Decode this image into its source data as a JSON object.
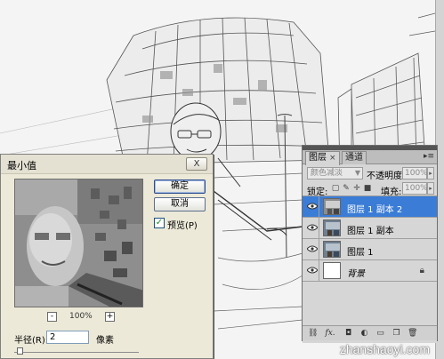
{
  "dialog": {
    "title": "最小值",
    "close_label": "X",
    "ok_label": "确定",
    "cancel_label": "取消",
    "preview_label": "预览(P)",
    "preview_checked": true,
    "zoom_minus": "-",
    "zoom_plus": "+",
    "zoom_value": "100%",
    "radius_label": "半径(R):",
    "radius_value": "2",
    "radius_unit": "像素"
  },
  "layers_panel": {
    "tab_layers": "图层",
    "tab_layers_close": "×",
    "tab_channels": "通道",
    "menu_glyph": "▸≡",
    "blend_mode": "颜色减淡",
    "opacity_label": "不透明度:",
    "opacity_value": "100%",
    "lock_label": "锁定:",
    "fill_label": "填充:",
    "fill_value": "100%",
    "layers": [
      {
        "name": "图层 1 副本 2",
        "selected": true,
        "thumb": "photo"
      },
      {
        "name": "图层 1 副本",
        "selected": false,
        "thumb": "photo"
      },
      {
        "name": "图层 1",
        "selected": false,
        "thumb": "photo"
      },
      {
        "name": "背景",
        "selected": false,
        "thumb": "white",
        "locked": true
      }
    ],
    "bottom_icons": [
      "link-icon",
      "fx-icon",
      "mask-icon",
      "adjustment-icon",
      "group-icon",
      "new-layer-icon",
      "trash-icon"
    ],
    "fx_label": "fx."
  },
  "watermark": "zhanshaoyi.com",
  "colors": {
    "selected_layer": "#3a7cd6",
    "panel_bg": "#d6d6d6",
    "dialog_bg": "#ece9d8"
  }
}
